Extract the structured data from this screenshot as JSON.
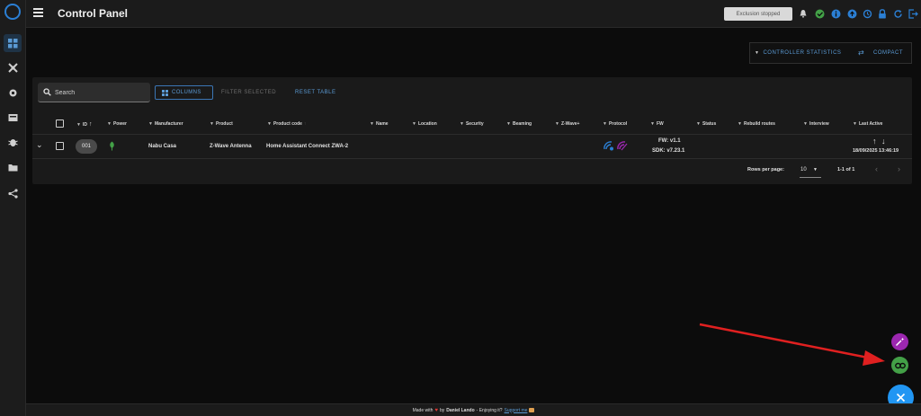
{
  "header": {
    "title": "Control Panel",
    "exclusion_status": "Exclusion stopped"
  },
  "toolbar": {
    "controller_statistics": "CONTROLLER STATISTICS",
    "compact": "COMPACT"
  },
  "table_controls": {
    "search_placeholder": "Search",
    "columns": "COLUMNS",
    "filter_selected": "FILTER SELECTED",
    "reset_table": "RESET TABLE"
  },
  "columns": [
    "ID",
    "Power",
    "Manufacturer",
    "Product",
    "Product code",
    "Name",
    "Location",
    "Security",
    "Beaming",
    "Z-Wave+",
    "Protocol",
    "FW",
    "Status",
    "Rebuild routes",
    "Interview",
    "Last Active"
  ],
  "row": {
    "id": "001",
    "manufacturer": "Nabu Casa",
    "product": "Z-Wave Antenna",
    "product_code": "Home Assistant Connect ZWA-2",
    "fw": "FW: v1.1",
    "sdk": "SDK: v7.23.1",
    "last_active": "18/09/2025 13:46:19"
  },
  "pagination": {
    "rows_per_page_label": "Rows per page:",
    "rows_per_page": "10",
    "range": "1-1 of 1"
  },
  "footer": {
    "made_with": "Made with",
    "by": "by",
    "author": "Daniel Lando",
    "enjoying": "- Enjoying it?",
    "support": "Support me"
  },
  "colors": {
    "accent": "#5b9bd5",
    "fab_purple": "#9c27b0",
    "fab_green": "#43a047",
    "fab_blue": "#2196f3",
    "annotation_arrow": "#e02020"
  }
}
